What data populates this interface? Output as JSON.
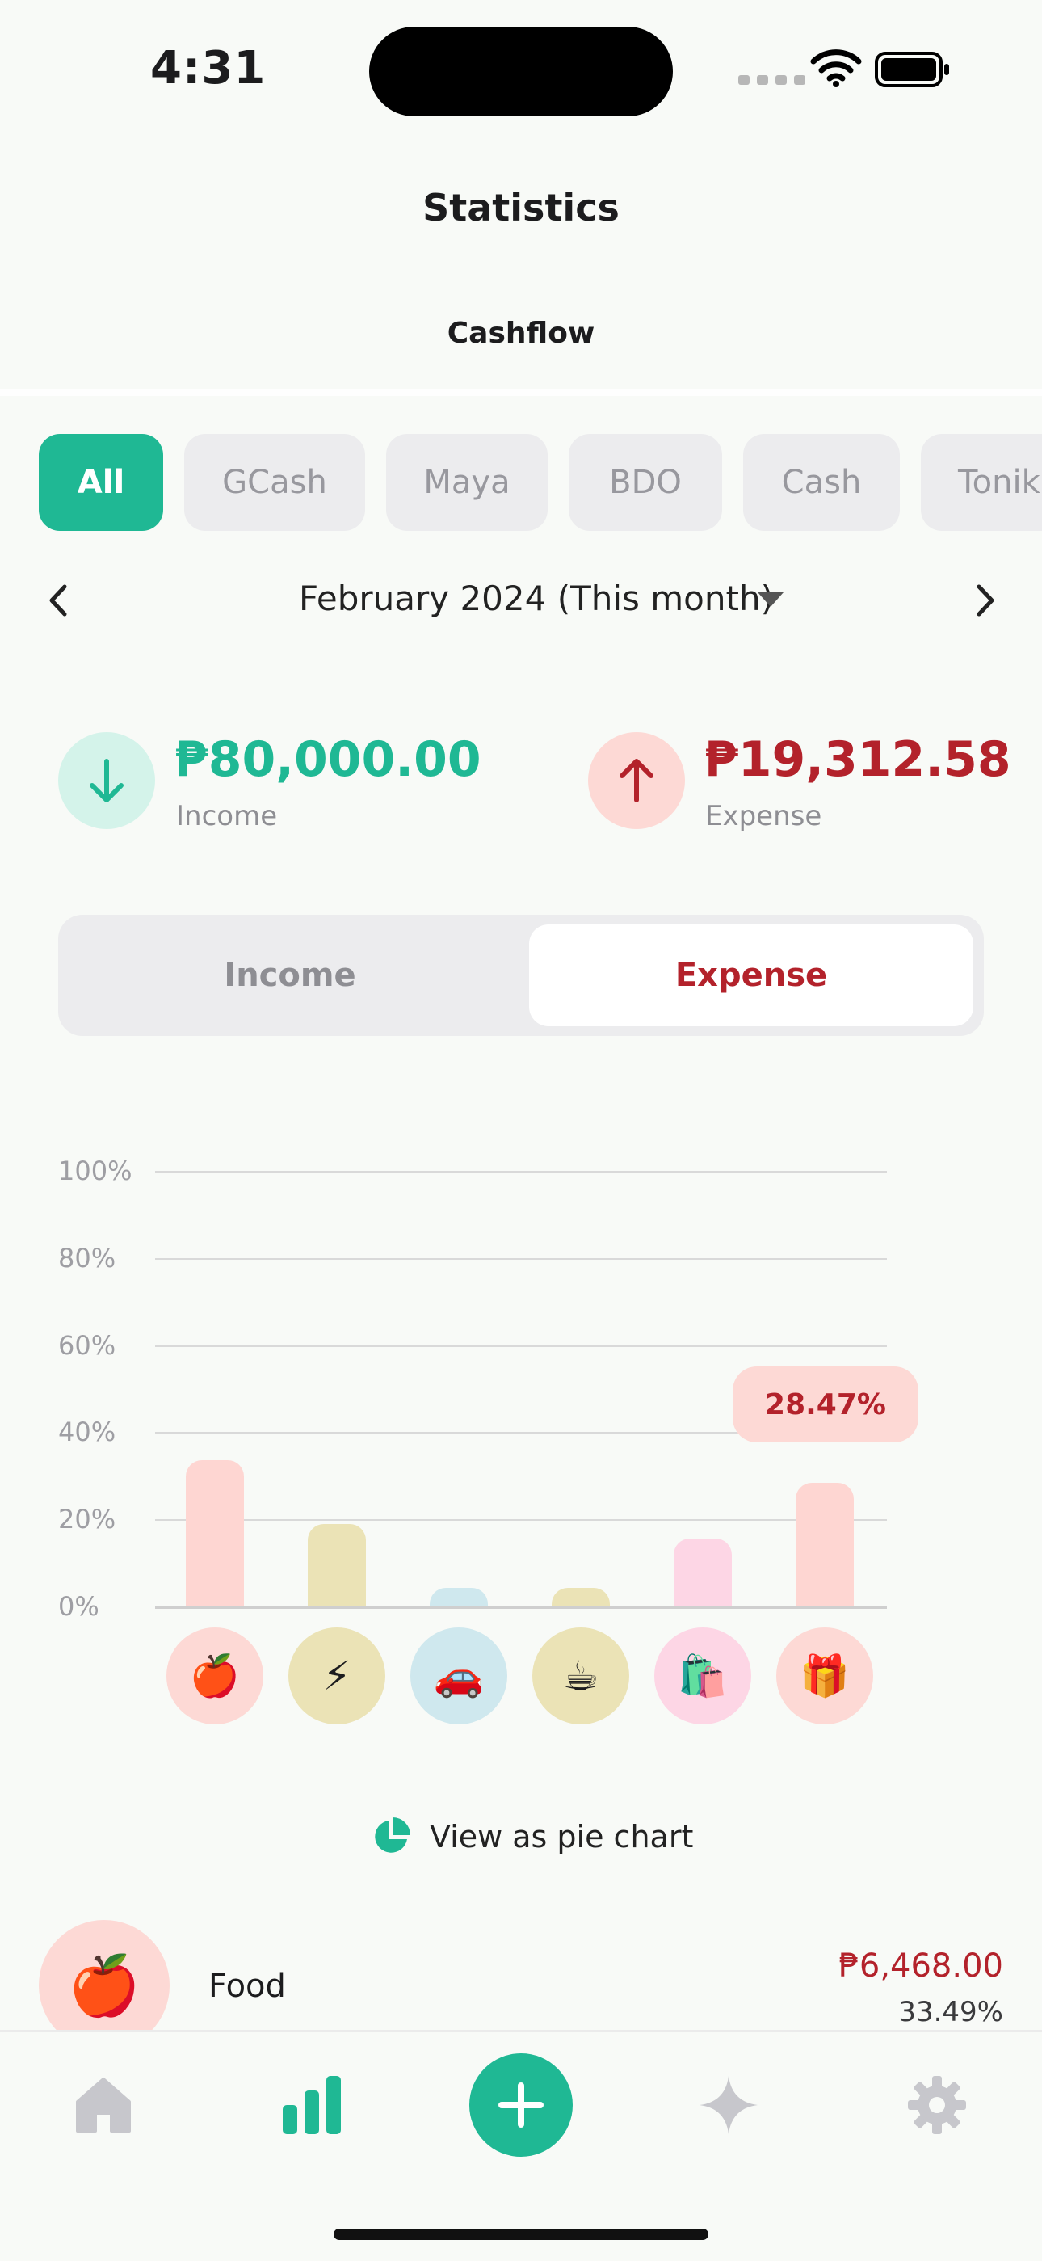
{
  "status_bar": {
    "time": "4:31"
  },
  "header": {
    "title": "Statistics",
    "subtitle": "Cashflow"
  },
  "accounts": {
    "chips": [
      "All",
      "GCash",
      "Maya",
      "BDO",
      "Cash",
      "Tonik"
    ],
    "selected": "All"
  },
  "period": {
    "label": "February 2024 (This month)"
  },
  "totals": {
    "income": {
      "amount": "₱80,000.00",
      "label": "Income",
      "color": "#1fb894"
    },
    "expense": {
      "amount": "₱19,312.58",
      "label": "Expense",
      "color": "#b3222b"
    }
  },
  "toggle": {
    "income_label": "Income",
    "expense_label": "Expense",
    "selected": "Expense"
  },
  "chart_data": {
    "type": "bar",
    "categories": [
      "Food",
      "Utilities",
      "Transport",
      "Coffee",
      "Shopping",
      "Gifts"
    ],
    "category_icons": [
      "🍎",
      "⚡",
      "🚗",
      "☕",
      "🛍️",
      "🎁"
    ],
    "values": [
      33.49,
      18.9,
      4.2,
      4.2,
      15.6,
      28.47
    ],
    "y_ticks": [
      "100%",
      "80%",
      "60%",
      "40%",
      "20%",
      "0%"
    ],
    "ylim": [
      0,
      100
    ],
    "grid": true,
    "colors": [
      "#fed6d2",
      "#ebe3b6",
      "#cfe8ee",
      "#ebe3b6",
      "#fdd6e5",
      "#fed6d2"
    ],
    "icon_bg": [
      "#fdd9d5",
      "#ebe3b6",
      "#cfe8ee",
      "#ebe3b6",
      "#fdd6e5",
      "#fdd9d5"
    ],
    "tooltip": "28.47%"
  },
  "pie_link": {
    "label": "View as pie chart"
  },
  "list": [
    {
      "icon": "🍎",
      "name": "Food",
      "amount": "₱6,468.00",
      "percent": "33.49%"
    }
  ]
}
